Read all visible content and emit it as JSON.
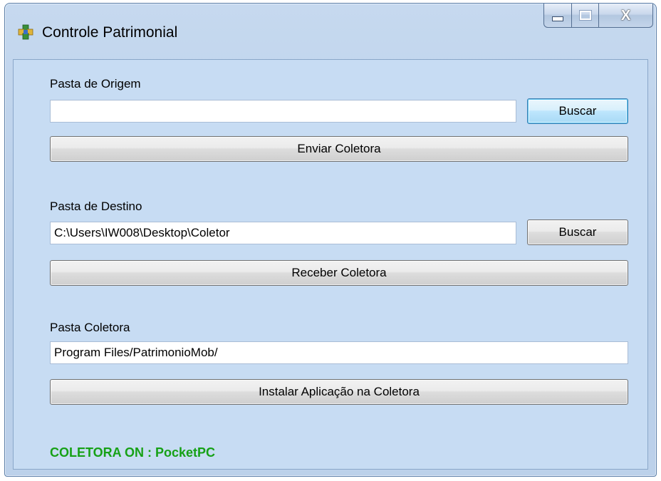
{
  "window": {
    "title": "Controle Patrimonial",
    "close_glyph": "X"
  },
  "origem": {
    "label": "Pasta de Origem",
    "value": "",
    "buscar_label": "Buscar",
    "enviar_label": "Enviar Coletora"
  },
  "destino": {
    "label": "Pasta de Destino",
    "value": "C:\\Users\\IW008\\Desktop\\Coletor",
    "buscar_label": "Buscar",
    "receber_label": "Receber Coletora"
  },
  "coletora": {
    "label": "Pasta Coletora",
    "value": "Program Files/PatrimonioMob/",
    "instalar_label": "Instalar Aplicação na Coletora"
  },
  "status": {
    "text": "COLETORA ON : PocketPC",
    "color": "#16a116"
  },
  "icons": {
    "app": "app-icon",
    "minimize": "minimize-icon",
    "maximize": "maximize-icon",
    "close": "close-icon"
  }
}
